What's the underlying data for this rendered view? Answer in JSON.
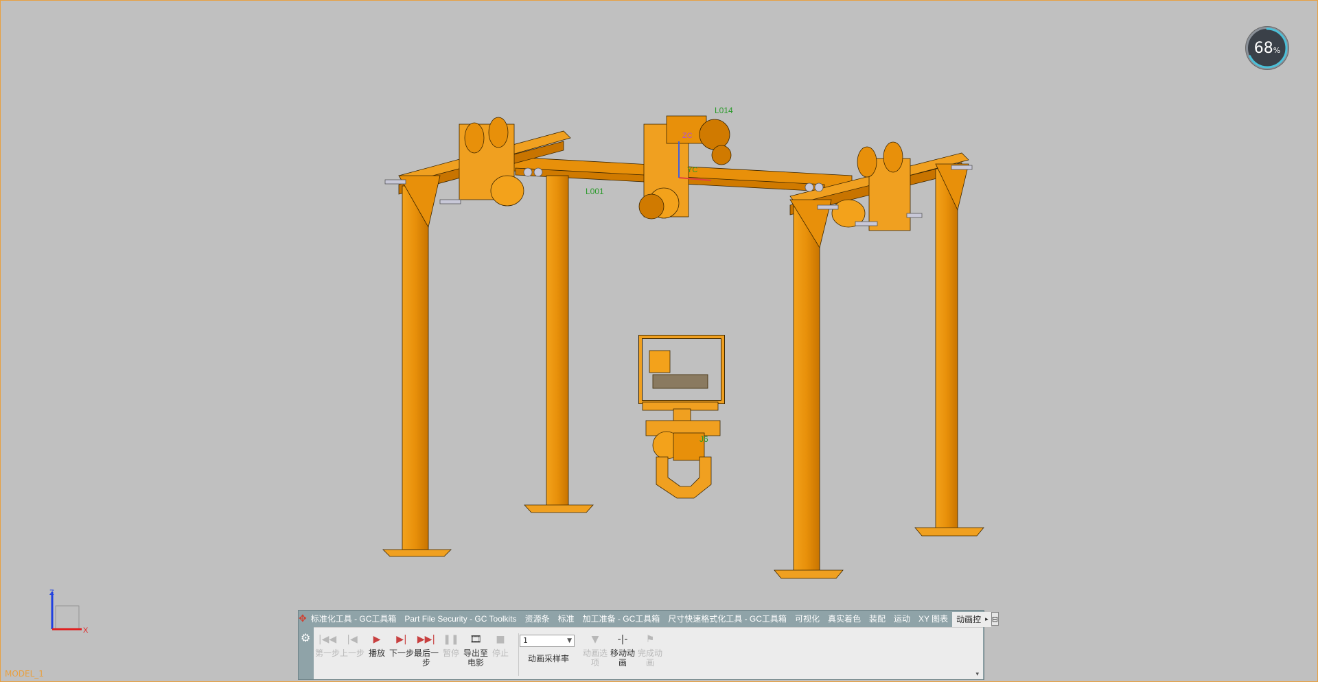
{
  "viewport": {
    "model_label": "MODEL_1",
    "performance": {
      "value": "68",
      "unit": "%",
      "fraction": 0.68
    },
    "annotations": [
      "L014",
      "L001",
      "ZC",
      "YC",
      "J6"
    ],
    "triad": {
      "z": "Z",
      "x": "X"
    }
  },
  "colors": {
    "background": "#c0c0c0",
    "frame": "#e8a040",
    "ribbon": "#8fa3a8",
    "accent_red": "#d04030"
  },
  "ribbon": {
    "tabs": [
      {
        "label": "标准化工具 - GC工具箱"
      },
      {
        "label": "Part File Security - GC Toolkits"
      },
      {
        "label": "资源条"
      },
      {
        "label": "标准"
      },
      {
        "label": "加工准备 - GC工具箱"
      },
      {
        "label": "尺寸快速格式化工具 - GC工具箱"
      },
      {
        "label": "可视化"
      },
      {
        "label": "真实着色"
      },
      {
        "label": "装配"
      },
      {
        "label": "运动"
      },
      {
        "label": "XY 图表"
      },
      {
        "label": "动画控"
      }
    ],
    "tools": [
      {
        "label": "第一步",
        "icon": "first-step-icon",
        "glyph": "|◀◀",
        "enabled": false
      },
      {
        "label": "上一步",
        "icon": "prev-step-icon",
        "glyph": "|◀",
        "enabled": false
      },
      {
        "label": "播放",
        "icon": "play-icon",
        "glyph": "▶",
        "enabled": true
      },
      {
        "label": "下一步",
        "icon": "next-step-icon",
        "glyph": "▶|",
        "enabled": true
      },
      {
        "label": "最后一步",
        "icon": "last-step-icon",
        "glyph": "▶▶|",
        "enabled": true
      },
      {
        "label": "暂停",
        "icon": "pause-icon",
        "glyph": "❚❚",
        "enabled": false
      },
      {
        "label": "导出至电影",
        "icon": "export-movie-icon",
        "glyph": "🎞",
        "enabled": true
      },
      {
        "label": "停止",
        "icon": "stop-icon",
        "glyph": "■",
        "enabled": false
      }
    ],
    "sample_rate": {
      "value": "1",
      "label": "动画采样率"
    },
    "tools2": [
      {
        "label": "动画选项",
        "icon": "animation-options-icon",
        "glyph": "▼",
        "enabled": false
      },
      {
        "label": "移动动画",
        "icon": "move-animation-icon",
        "glyph": "-|-",
        "enabled": true
      },
      {
        "label": "完成动画",
        "icon": "finish-animation-icon",
        "glyph": "⚑",
        "enabled": false
      }
    ]
  }
}
